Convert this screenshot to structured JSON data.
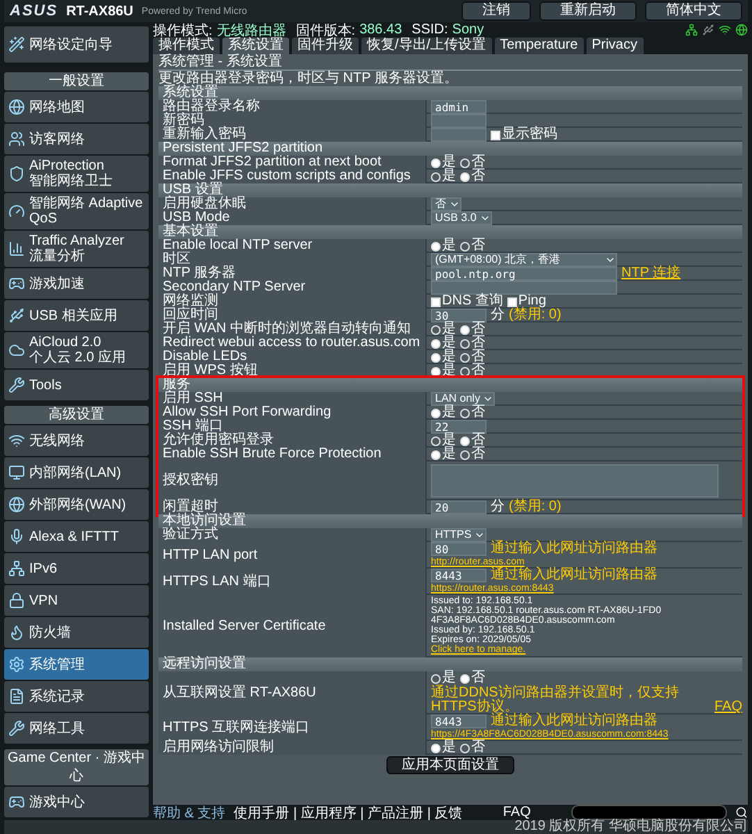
{
  "header": {
    "logo": "ASUS",
    "model": "RT-AX86U",
    "powered": "Powered by Trend Micro",
    "buttons": [
      "注销",
      "重新启动"
    ],
    "language": "简体中文"
  },
  "info": {
    "mode_label": "操作模式:",
    "mode": "无线路由器",
    "fw_label": "固件版本:",
    "fw": "386.43",
    "ssid_label": "SSID:",
    "ssid": "Sony"
  },
  "sidebar": [
    {
      "kind": "wizard",
      "label": "网络设定向导",
      "selected": false
    },
    {
      "kind": "header",
      "label": "一般设置"
    },
    {
      "kind": "item",
      "label": "网络地图",
      "selected": false
    },
    {
      "kind": "item",
      "label": "访客网络",
      "selected": false
    },
    {
      "kind": "item",
      "label": "AiProtection",
      "sublabel": "智能网络卫士",
      "selected": false
    },
    {
      "kind": "item",
      "label": "智能网络 Adaptive",
      "sublabel": "QoS",
      "selected": false
    },
    {
      "kind": "item",
      "label": "Traffic Analyzer",
      "sublabel": "流量分析",
      "selected": false
    },
    {
      "kind": "item",
      "label": "游戏加速",
      "selected": false
    },
    {
      "kind": "item",
      "label": "USB 相关应用",
      "selected": false
    },
    {
      "kind": "item",
      "label": "AiCloud 2.0",
      "sublabel": "个人云 2.0 应用",
      "selected": false
    },
    {
      "kind": "item",
      "label": "Tools",
      "selected": false
    },
    {
      "kind": "header",
      "label": "高级设置"
    },
    {
      "kind": "item",
      "label": "无线网络",
      "selected": false
    },
    {
      "kind": "item",
      "label": "内部网络(LAN)",
      "selected": false
    },
    {
      "kind": "item",
      "label": "外部网络(WAN)",
      "selected": false
    },
    {
      "kind": "item",
      "label": "Alexa & IFTTT",
      "selected": false
    },
    {
      "kind": "item",
      "label": "IPv6",
      "selected": false
    },
    {
      "kind": "item",
      "label": "VPN",
      "selected": false
    },
    {
      "kind": "item",
      "label": "防火墙",
      "selected": false
    },
    {
      "kind": "item",
      "label": "系统管理",
      "selected": true
    },
    {
      "kind": "item",
      "label": "系统记录",
      "selected": false
    },
    {
      "kind": "item",
      "label": "网络工具",
      "selected": false
    },
    {
      "kind": "header",
      "label": "Game Center · 游戏中心"
    },
    {
      "kind": "item",
      "label": "游戏中心",
      "selected": false
    }
  ],
  "tabs": [
    {
      "label": "操作模式",
      "selected": false
    },
    {
      "label": "系统设置",
      "selected": true
    },
    {
      "label": "固件升级",
      "selected": false
    },
    {
      "label": "恢复/导出/上传设置",
      "selected": false
    },
    {
      "label": "Temperature",
      "selected": false
    },
    {
      "label": "Privacy",
      "selected": false
    }
  ],
  "title": "系统管理 - 系统设置",
  "description": "更改路由器登录密码，时区与 NTP 服务器设置。",
  "sections": [
    {
      "title": "系统设置",
      "highlighted": false,
      "rows": [
        {
          "label": "路由器登录名称",
          "kind": "field",
          "value": "admin"
        },
        {
          "label": "新密码",
          "kind": "field"
        },
        {
          "label": "重新输入密码",
          "kind": "field",
          "checks": [
            {
              "label": "显示密码",
              "checked": false
            }
          ]
        }
      ]
    },
    {
      "title": "Persistent JFFS2 partition",
      "highlighted": false,
      "rows": [
        {
          "label": "Format JFFS2 partition at next boot",
          "kind": "radio",
          "options": [
            {
              "label": "是",
              "selected": true
            },
            {
              "label": "否",
              "selected": false
            }
          ]
        },
        {
          "label": "Enable JFFS custom scripts and configs",
          "kind": "radio",
          "options": [
            {
              "label": "是",
              "selected": false
            },
            {
              "label": "否",
              "selected": true
            }
          ]
        }
      ]
    },
    {
      "title": "USB 设置",
      "highlighted": false,
      "rows": [
        {
          "label": "启用硬盘休眠",
          "kind": "select",
          "value": "否"
        },
        {
          "label": "USB Mode",
          "kind": "select",
          "value": "USB 3.0"
        }
      ]
    },
    {
      "title": "基本设置",
      "highlighted": false,
      "rows": [
        {
          "label": "Enable local NTP server",
          "kind": "radio",
          "options": [
            {
              "label": "是",
              "selected": true
            },
            {
              "label": "否",
              "selected": false
            }
          ]
        },
        {
          "label": "时区",
          "kind": "select",
          "value": "(GMT+08:00) 北京，香港",
          "wide": true
        },
        {
          "label": "NTP 服务器",
          "kind": "field",
          "value": "pool.ntp.org",
          "wide": true,
          "link": "NTP 连接"
        },
        {
          "label": "Secondary NTP Server",
          "kind": "field",
          "wide": true
        },
        {
          "label": "网络监测",
          "kind": "checks",
          "checks": [
            {
              "label": "DNS 查询",
              "checked": false
            },
            {
              "label": "Ping",
              "checked": false
            }
          ]
        },
        {
          "label": "回应时间",
          "kind": "field",
          "value": "30",
          "unit": "分",
          "hint": "(禁用: 0)"
        },
        {
          "label": "开启 WAN 中断时的浏览器自动转向通知",
          "kind": "radio",
          "options": [
            {
              "label": "是",
              "selected": false
            },
            {
              "label": "否",
              "selected": true
            }
          ]
        },
        {
          "label": "Redirect webui access to router.asus.com",
          "kind": "radio",
          "options": [
            {
              "label": "是",
              "selected": true
            },
            {
              "label": "否",
              "selected": false
            }
          ]
        },
        {
          "label": "Disable LEDs",
          "kind": "radio",
          "options": [
            {
              "label": "是",
              "selected": true
            },
            {
              "label": "否",
              "selected": false
            }
          ]
        },
        {
          "label": "启用 WPS 按钮",
          "kind": "radio",
          "options": [
            {
              "label": "是",
              "selected": true
            },
            {
              "label": "否",
              "selected": false
            }
          ]
        }
      ]
    },
    {
      "title": "服务",
      "highlighted": true,
      "rows": [
        {
          "label": "启用 SSH",
          "kind": "select",
          "value": "LAN only"
        },
        {
          "label": "Allow SSH Port Forwarding",
          "kind": "radio",
          "options": [
            {
              "label": "是",
              "selected": true
            },
            {
              "label": "否",
              "selected": false
            }
          ]
        },
        {
          "label": "SSH 端口",
          "kind": "field",
          "value": "22"
        },
        {
          "label": "允许使用密码登录",
          "kind": "radio",
          "options": [
            {
              "label": "是",
              "selected": false
            },
            {
              "label": "否",
              "selected": true
            }
          ]
        },
        {
          "label": "Enable SSH Brute Force Protection",
          "kind": "radio",
          "options": [
            {
              "label": "是",
              "selected": true
            },
            {
              "label": "否",
              "selected": false
            }
          ]
        },
        {
          "label": "授权密钥",
          "kind": "textarea"
        },
        {
          "label": "闲置超时",
          "kind": "field",
          "value": "20",
          "unit": "分",
          "hint": "(禁用: 0)"
        }
      ]
    },
    {
      "title": "本地访问设置",
      "highlighted": false,
      "rows": [
        {
          "label": "验证方式",
          "kind": "select",
          "value": "HTTPS"
        },
        {
          "label": "HTTP LAN port",
          "kind": "field",
          "value": "80",
          "note": "通过输入此网址访问路由器",
          "link": "http://router.asus.com"
        },
        {
          "label": "HTTPS LAN 端口",
          "kind": "field",
          "value": "8443",
          "note": "通过输入此网址访问路由器",
          "link": "https://router.asus.com:8443"
        },
        {
          "label": "Installed Server Certificate",
          "kind": "cert",
          "lines": [
            {
              "key": "Issued to:",
              "value": "192.168.50.1"
            },
            {
              "key": "SAN:",
              "value": "192.168.50.1 router.asus.com RT-AX86U-1FD0"
            },
            {
              "value": "4F3A8F8AC6D028B4DE0.asuscomm.com"
            },
            {
              "key": "Issued by:",
              "value": "192.168.50.1"
            },
            {
              "key": "Expires on:",
              "value": "2029/05/05"
            }
          ],
          "link": "Click here to manage."
        }
      ]
    },
    {
      "title": "远程访问设置",
      "highlighted": false,
      "rows": [
        {
          "label": "从互联网设置 RT-AX86U",
          "kind": "radio",
          "options": [
            {
              "label": "是",
              "selected": false
            },
            {
              "label": "否",
              "selected": true
            }
          ],
          "note": "通过DDNS访问路由器并设置时，仅支持HTTPS协议。",
          "link": "FAQ"
        },
        {
          "label": "HTTPS 互联网连接端口",
          "kind": "field",
          "value": "8443",
          "note": "通过输入此网址访问路由器",
          "link": "https://4F3A8F8AC6D028B4DE0.asuscomm.com:8443"
        },
        {
          "label": "启用网络访问限制",
          "kind": "radio",
          "options": [
            {
              "label": "是",
              "selected": true
            },
            {
              "label": "否",
              "selected": false
            }
          ]
        }
      ]
    }
  ],
  "apply": "应用本页面设置",
  "footer": {
    "help": "帮助 & 支持",
    "links": "使用手册 | 应用程序 | 产品注册 | 反馈",
    "faq": "FAQ"
  },
  "copyright": "2019 版权所有 华硕电脑股份有限公司"
}
